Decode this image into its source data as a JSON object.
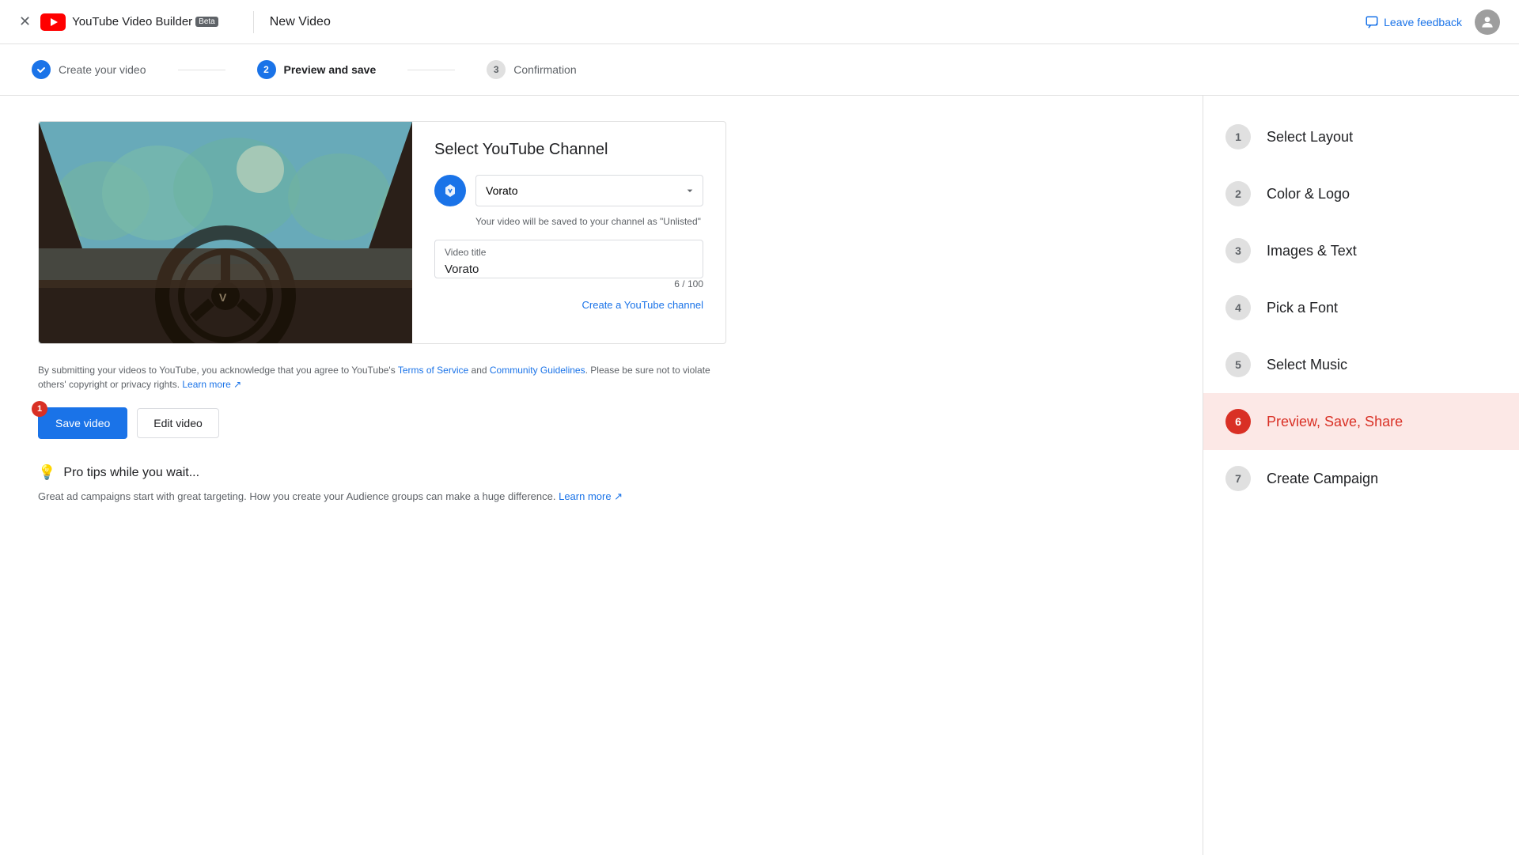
{
  "header": {
    "brand": "YouTube Video Builder",
    "beta": "Beta",
    "title": "New Video",
    "feedback_label": "Leave feedback",
    "close_icon": "×"
  },
  "stepper": {
    "steps": [
      {
        "num": "✓",
        "label": "Create your video",
        "state": "completed"
      },
      {
        "num": "2",
        "label": "Preview and save",
        "state": "active"
      },
      {
        "num": "3",
        "label": "Confirmation",
        "state": "inactive"
      }
    ]
  },
  "channel_section": {
    "title": "Select YouTube Channel",
    "channel_name": "Vorato",
    "unlisted_notice": "Your video will be saved to your channel as \"Unlisted\"",
    "video_title_label": "Video title",
    "video_title_value": "Vorato",
    "char_count": "6 / 100",
    "create_channel_link": "Create a YouTube channel"
  },
  "terms": {
    "text": "By submitting your videos to YouTube, you acknowledge that you agree to YouTube's Terms of Service and Community Guidelines. Please be sure not to violate others' copyright or privacy rights.",
    "learn_more": "Learn more"
  },
  "buttons": {
    "save_video": "Save video",
    "edit_video": "Edit video",
    "notification_count": "1"
  },
  "pro_tips": {
    "title": "Pro tips while you wait...",
    "text": "Great ad campaigns start with great targeting. How you create your Audience groups can make a huge difference.",
    "learn_more": "Learn more"
  },
  "sidebar": {
    "items": [
      {
        "num": "1",
        "label": "Select Layout",
        "state": "default"
      },
      {
        "num": "2",
        "label": "Color & Logo",
        "state": "default"
      },
      {
        "num": "3",
        "label": "Images & Text",
        "state": "default"
      },
      {
        "num": "4",
        "label": "Pick a Font",
        "state": "default"
      },
      {
        "num": "5",
        "label": "Select Music",
        "state": "default"
      },
      {
        "num": "6",
        "label": "Preview, Save, Share",
        "state": "active"
      },
      {
        "num": "7",
        "label": "Create Campaign",
        "state": "default"
      }
    ]
  }
}
